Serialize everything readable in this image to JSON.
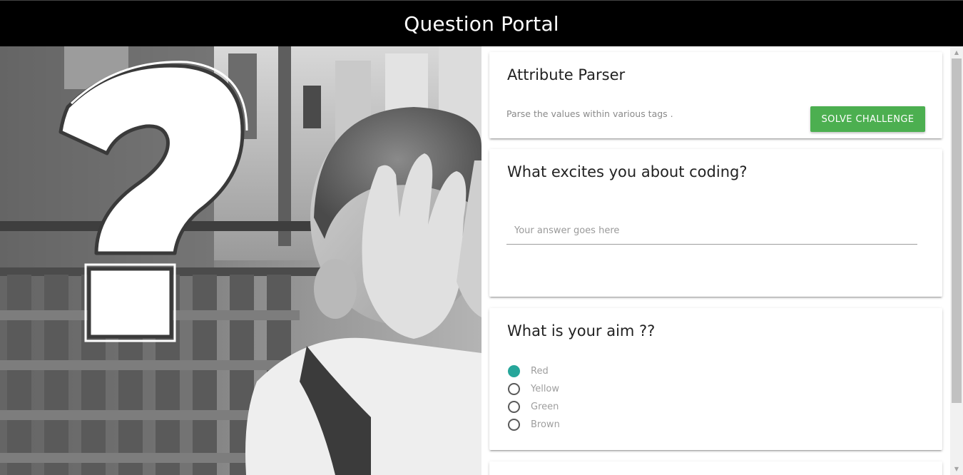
{
  "header": {
    "title": "Question Portal"
  },
  "cards": {
    "challenge": {
      "title": "Attribute Parser",
      "description": "Parse the values within various tags .",
      "button_label": "SOLVE CHALLENGE"
    },
    "coding": {
      "title": "What excites you about coding?",
      "input_value": "",
      "input_placeholder": "Your answer goes here"
    },
    "aim": {
      "title": "What is your aim ??",
      "options": [
        {
          "label": "Red",
          "checked": true
        },
        {
          "label": "Yellow",
          "checked": false
        },
        {
          "label": "Green",
          "checked": false
        },
        {
          "label": "Brown",
          "checked": false
        }
      ]
    }
  },
  "hero": {
    "icon": "question-mark-icon"
  },
  "colors": {
    "header_bg": "#000000",
    "button": "#4caf50",
    "radio_checked": "#26a69a"
  },
  "scrollbar": {
    "up_icon": "scroll-up-arrow-icon",
    "down_icon": "scroll-down-arrow-icon"
  }
}
